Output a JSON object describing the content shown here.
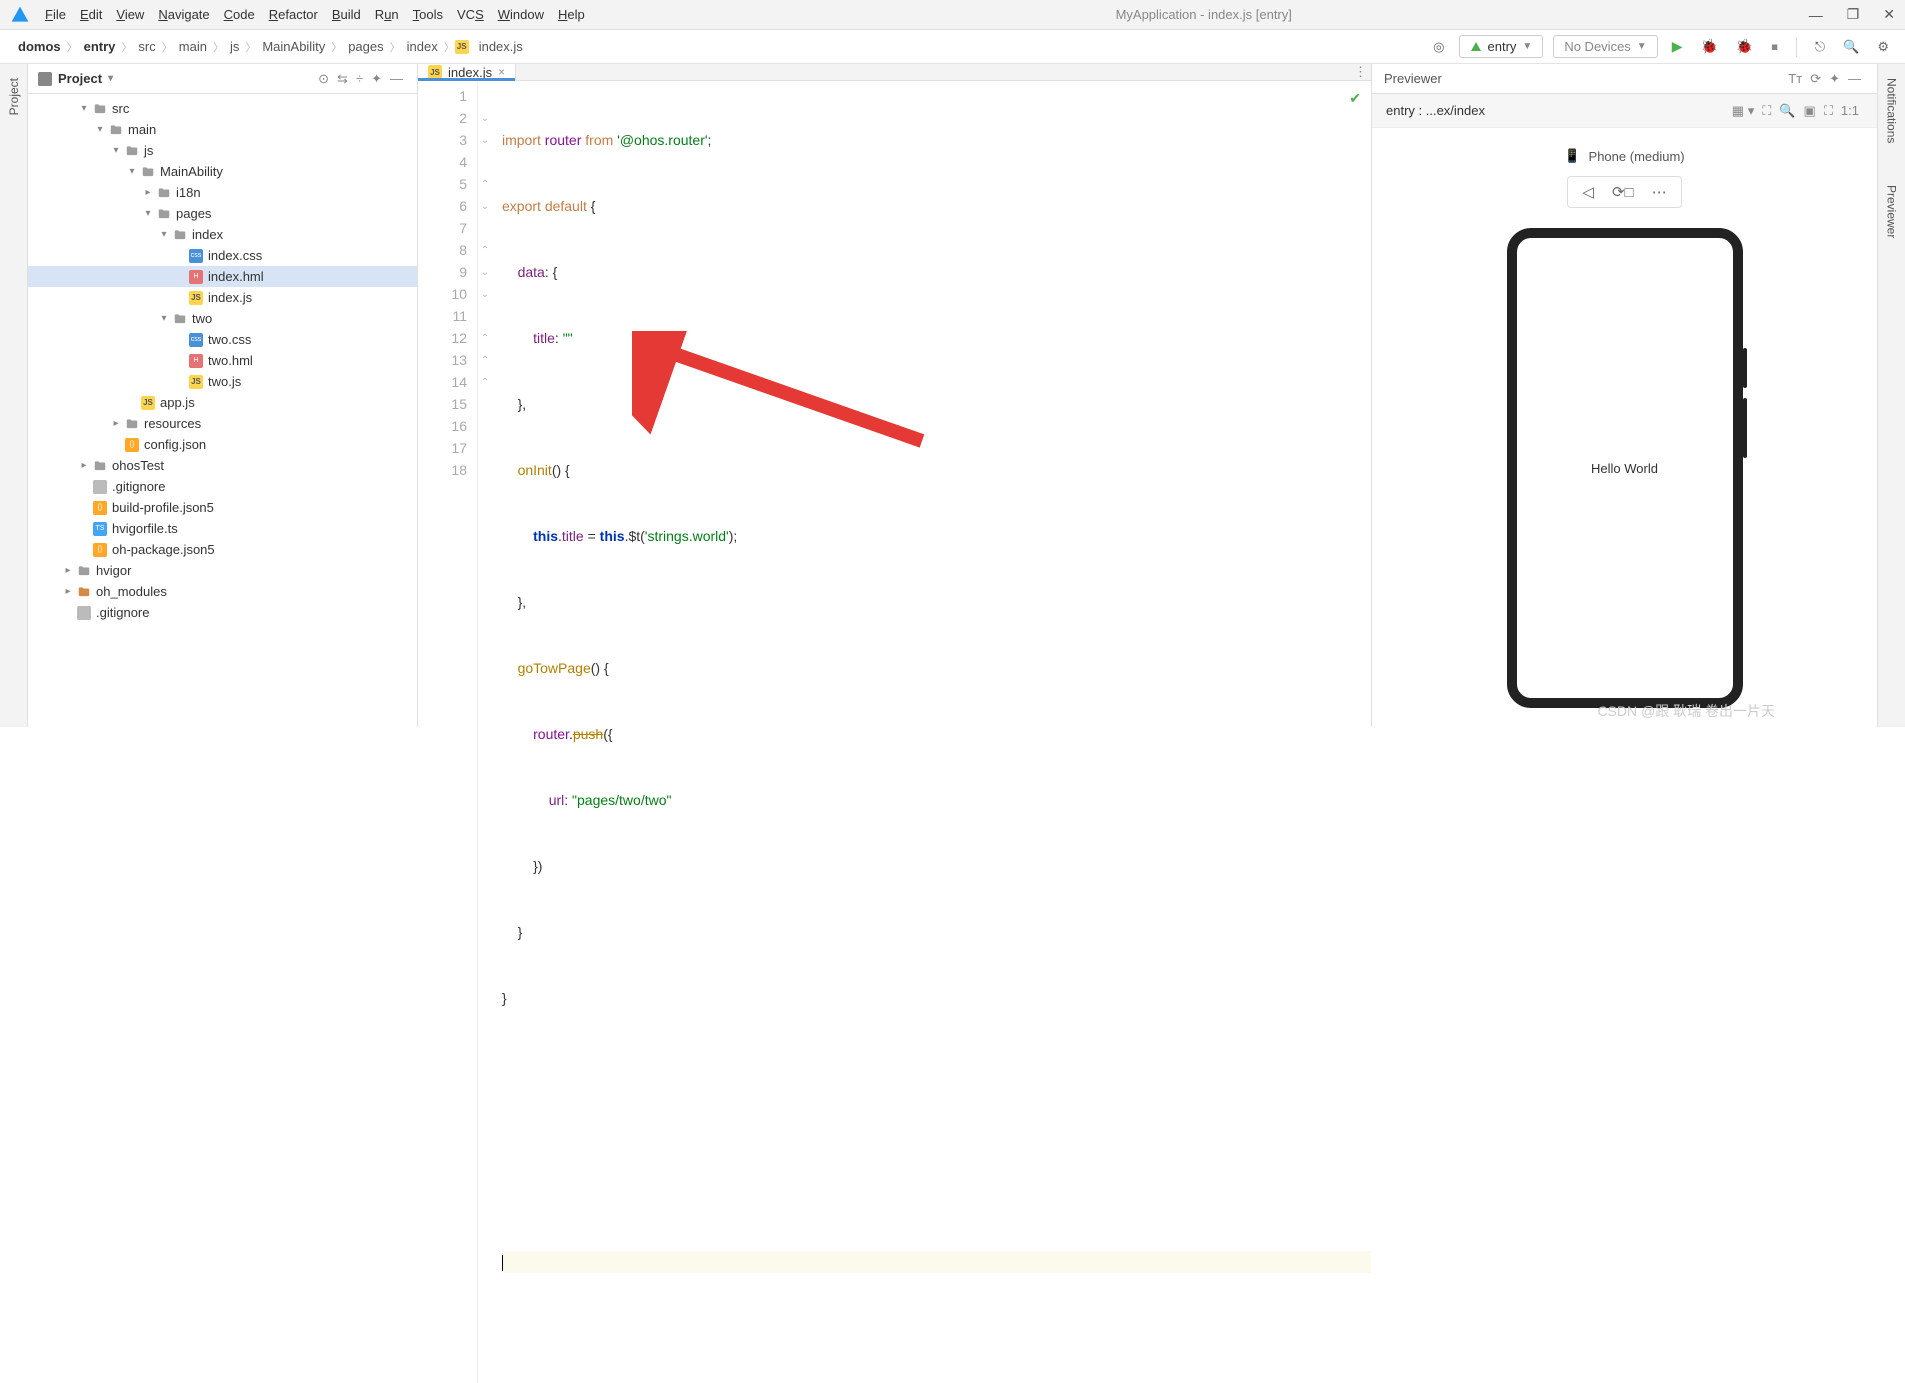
{
  "window": {
    "title": "MyApplication - index.js [entry]"
  },
  "menu": [
    "File",
    "Edit",
    "View",
    "Navigate",
    "Code",
    "Refactor",
    "Build",
    "Run",
    "Tools",
    "VCS",
    "Window",
    "Help"
  ],
  "breadcrumbs": [
    "domos",
    "entry",
    "src",
    "main",
    "js",
    "MainAbility",
    "pages",
    "index",
    "index.js"
  ],
  "toolbar": {
    "config": "entry",
    "devices": "No Devices"
  },
  "project": {
    "title": "Project",
    "tree": [
      {
        "depth": 3,
        "arrow": "down",
        "icon": "folder",
        "label": "src"
      },
      {
        "depth": 4,
        "arrow": "down",
        "icon": "folder",
        "label": "main"
      },
      {
        "depth": 5,
        "arrow": "down",
        "icon": "folder",
        "label": "js"
      },
      {
        "depth": 6,
        "arrow": "down",
        "icon": "folder",
        "label": "MainAbility"
      },
      {
        "depth": 7,
        "arrow": "right",
        "icon": "folder",
        "label": "i18n"
      },
      {
        "depth": 7,
        "arrow": "down",
        "icon": "folder",
        "label": "pages"
      },
      {
        "depth": 8,
        "arrow": "down",
        "icon": "folder",
        "label": "index"
      },
      {
        "depth": 9,
        "arrow": "",
        "icon": "css",
        "label": "index.css"
      },
      {
        "depth": 9,
        "arrow": "",
        "icon": "hml",
        "label": "index.hml",
        "selected": true
      },
      {
        "depth": 9,
        "arrow": "",
        "icon": "js",
        "label": "index.js"
      },
      {
        "depth": 8,
        "arrow": "down",
        "icon": "folder",
        "label": "two"
      },
      {
        "depth": 9,
        "arrow": "",
        "icon": "css",
        "label": "two.css"
      },
      {
        "depth": 9,
        "arrow": "",
        "icon": "hml",
        "label": "two.hml"
      },
      {
        "depth": 9,
        "arrow": "",
        "icon": "js",
        "label": "two.js"
      },
      {
        "depth": 6,
        "arrow": "",
        "icon": "js",
        "label": "app.js"
      },
      {
        "depth": 5,
        "arrow": "right",
        "icon": "folder",
        "label": "resources"
      },
      {
        "depth": 5,
        "arrow": "",
        "icon": "json",
        "label": "config.json"
      },
      {
        "depth": 3,
        "arrow": "right",
        "icon": "folder",
        "label": "ohosTest"
      },
      {
        "depth": 3,
        "arrow": "",
        "icon": "file",
        "label": ".gitignore"
      },
      {
        "depth": 3,
        "arrow": "",
        "icon": "json",
        "label": "build-profile.json5"
      },
      {
        "depth": 3,
        "arrow": "",
        "icon": "ts",
        "label": "hvigorfile.ts"
      },
      {
        "depth": 3,
        "arrow": "",
        "icon": "json",
        "label": "oh-package.json5"
      },
      {
        "depth": 2,
        "arrow": "right",
        "icon": "folder",
        "label": "hvigor"
      },
      {
        "depth": 2,
        "arrow": "right",
        "icon": "folder-orange",
        "label": "oh_modules"
      },
      {
        "depth": 2,
        "arrow": "",
        "icon": "file",
        "label": ".gitignore"
      }
    ]
  },
  "editor": {
    "tab": "index.js",
    "lines_count": 18,
    "code": {
      "l1": {
        "import": "import",
        "router": "router",
        "from": "from",
        "str": "'@ohos.router'",
        "semi": ";"
      },
      "l2": {
        "export": "export",
        "default": "default",
        "brace": "{"
      },
      "l3": {
        "data": "data",
        "colon": ":",
        "brace": "{"
      },
      "l4": {
        "title": "title",
        "colon": ":",
        "str": "\"\""
      },
      "l5": {
        "brace": "},"
      },
      "l6": {
        "onInit": "onInit",
        "paren": "()",
        "brace": "{"
      },
      "l7": {
        "this1": "this",
        "dot": ".",
        "title": "title",
        "eq": " = ",
        "this2": "this",
        "dollar": ".$t(",
        "str": "'strings.world'",
        "close": ");"
      },
      "l8": {
        "brace": "},"
      },
      "l9": {
        "goTowPage": "goTowPage",
        "paren": "()",
        "brace": "{"
      },
      "l10": {
        "router": "router",
        "dot": ".",
        "push": "push",
        "open": "({"
      },
      "l11": {
        "url": "url",
        "colon": ": ",
        "str": "\"pages/two/two\""
      },
      "l12": {
        "close": "})"
      },
      "l13": {
        "brace": "}"
      },
      "l14": {
        "brace": "}"
      }
    }
  },
  "previewer": {
    "title": "Previewer",
    "path": "entry : ...ex/index",
    "device": "Phone (medium)",
    "content": "Hello World"
  },
  "left_stripe": "Project",
  "right_stripe": [
    "Notifications",
    "Previewer"
  ],
  "watermark": "CSDN @跟 耿瑞 卷出一片天"
}
